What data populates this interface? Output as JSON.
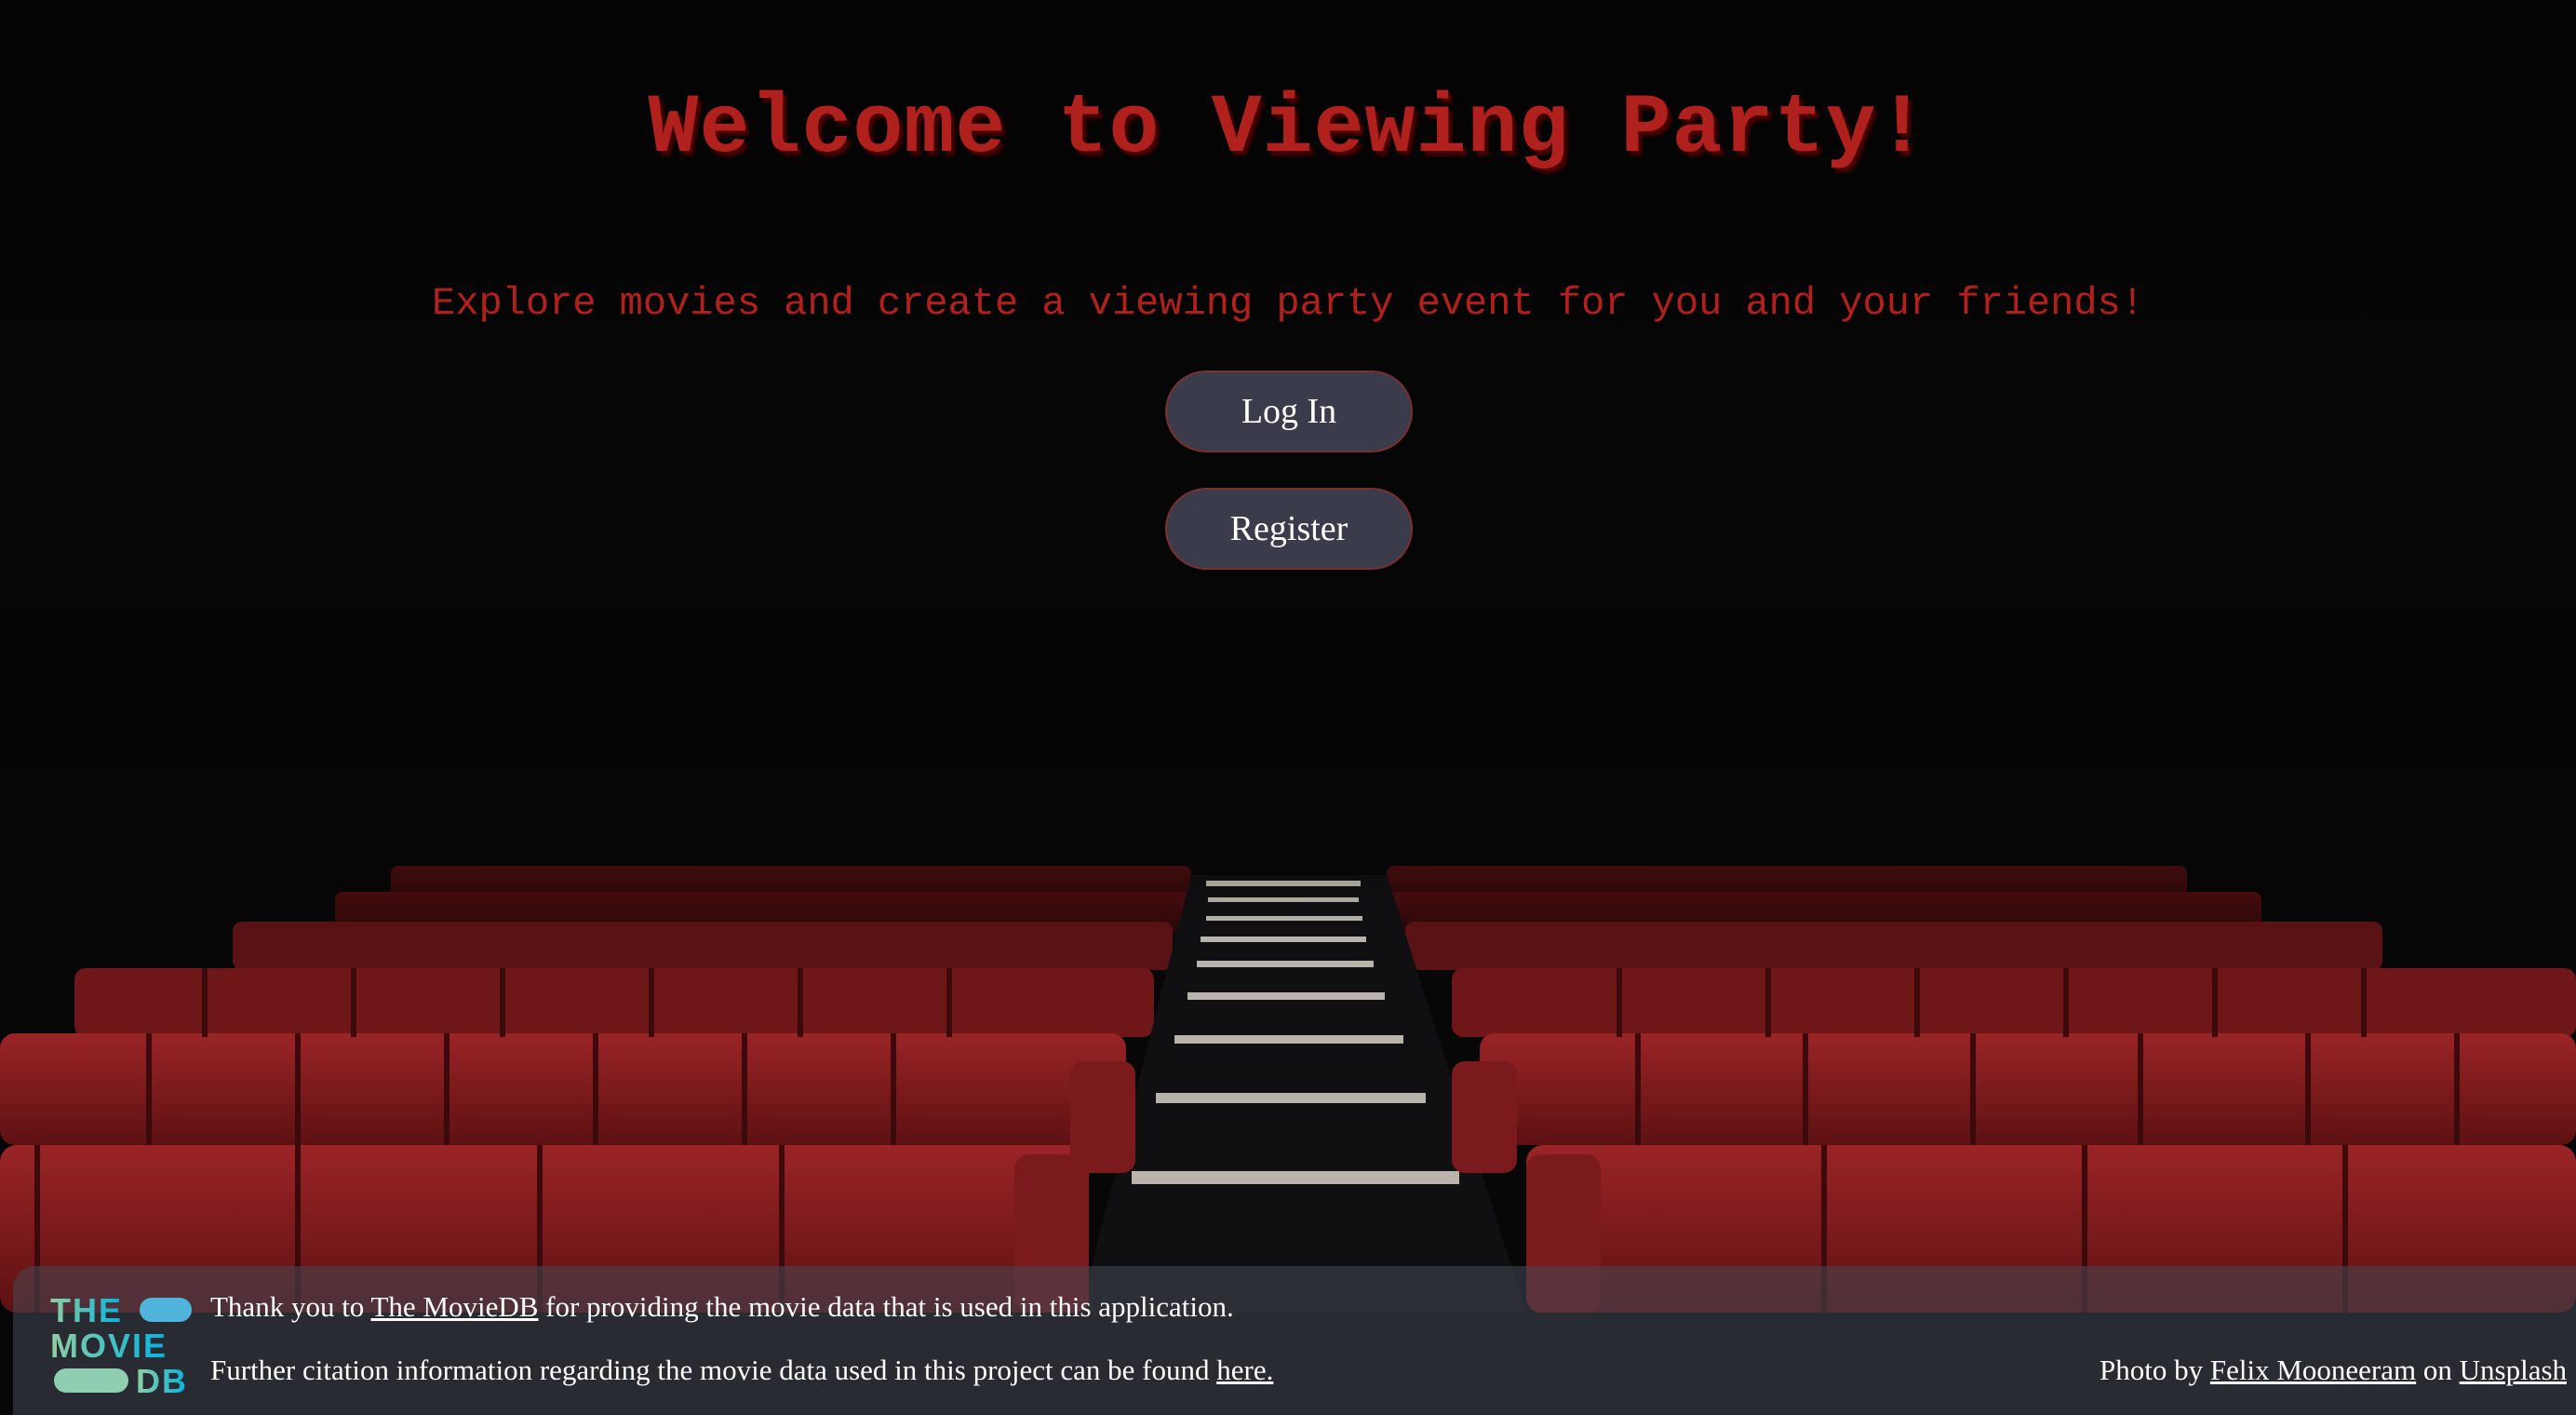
{
  "header": {
    "title": "Welcome to Viewing Party!",
    "subtitle": "Explore movies and create a viewing party event for you and your friends!"
  },
  "actions": {
    "login_label": "Log In",
    "register_label": "Register"
  },
  "footer": {
    "logo": {
      "icon": "tmdb-logo",
      "word1": "THE",
      "word2": "MOVIE",
      "word3": "DB"
    },
    "line1_prefix": "Thank you to ",
    "line1_link": "The MovieDB",
    "line1_suffix": " for providing the movie data that is used in this application.",
    "line2_prefix": "Further citation information regarding the movie data used in this project can be found ",
    "line2_link": "here.",
    "photo_prefix": "Photo by ",
    "photo_author": "Felix Mooneeram",
    "photo_mid": " on ",
    "photo_site": "Unsplash"
  },
  "colors": {
    "title_red": "#b0201c",
    "seat_red": "#8a1a1c",
    "button_bg": "#3a3b4b",
    "footer_bg": "#464856"
  }
}
